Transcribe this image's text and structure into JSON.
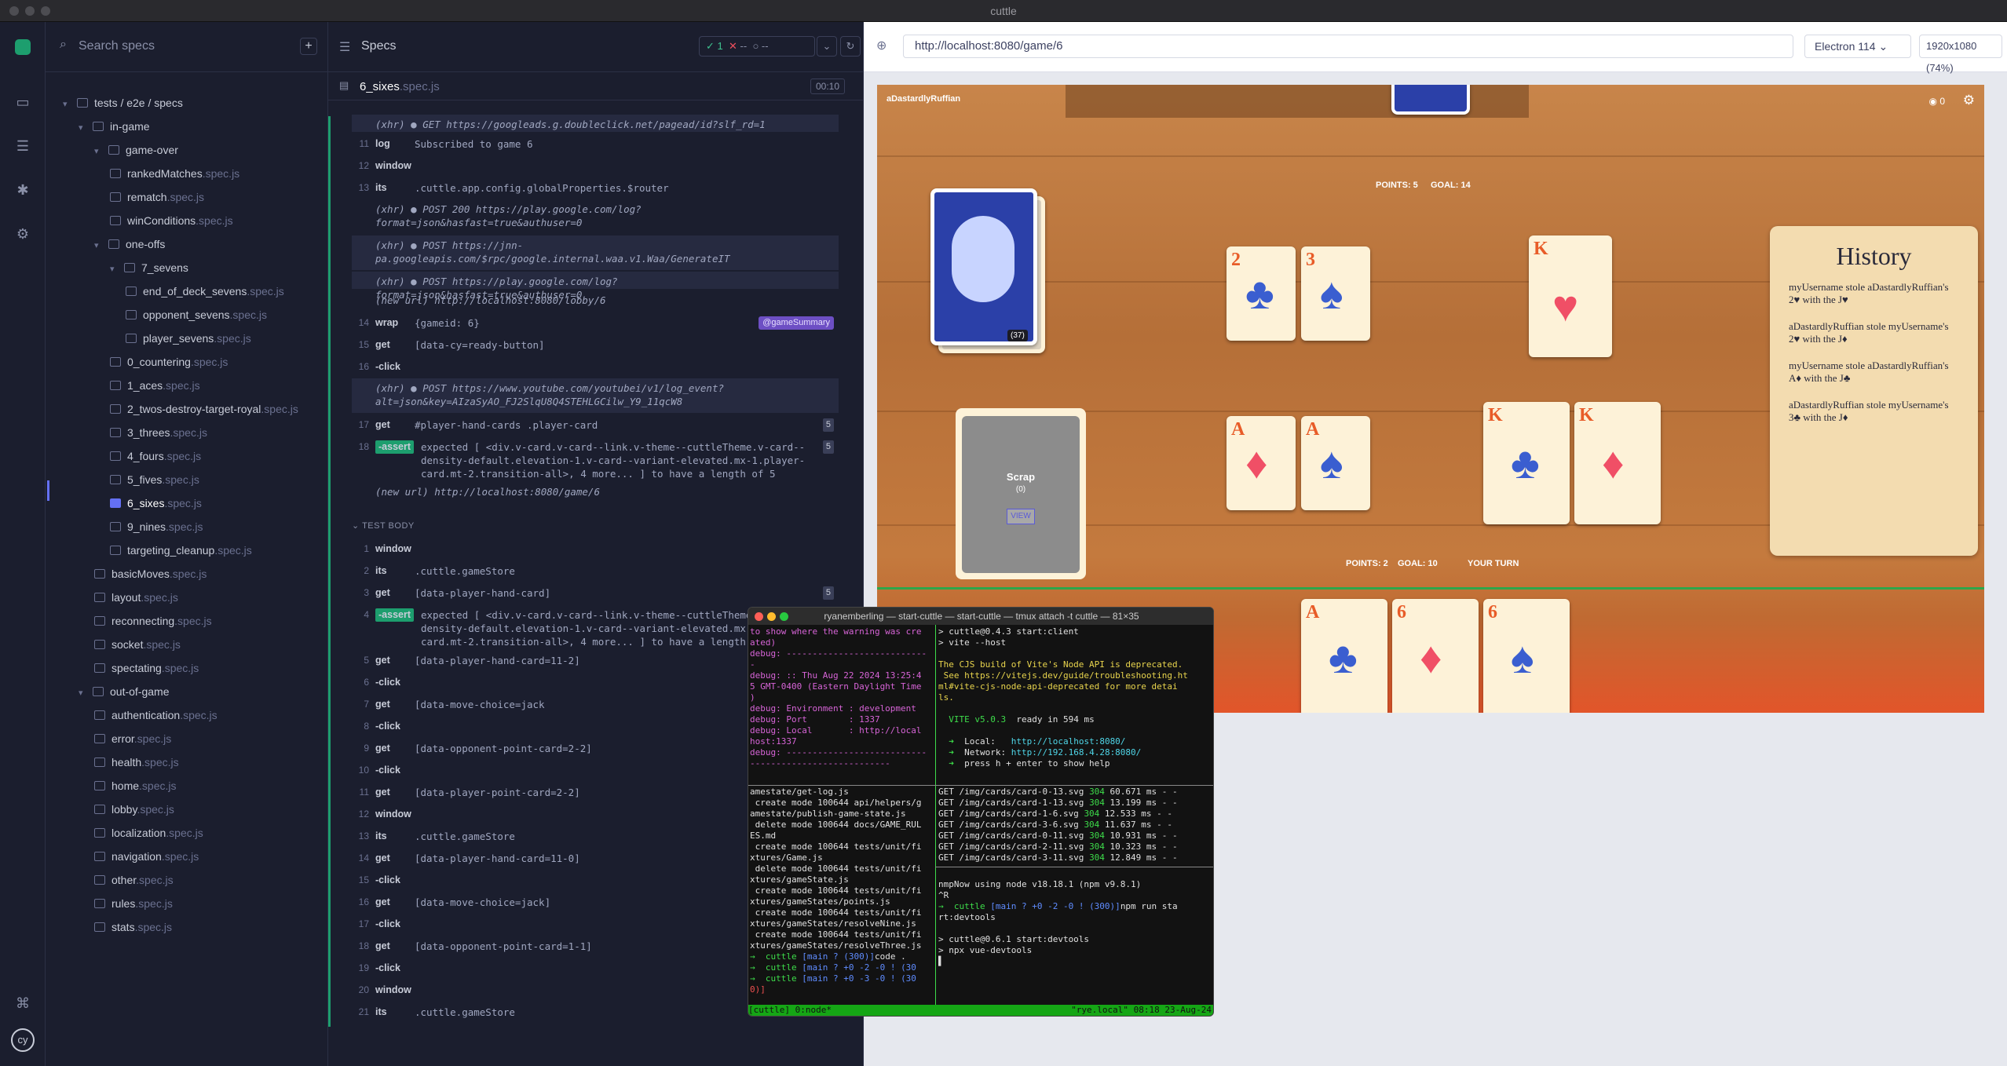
{
  "window_title": "cuttle",
  "specs_panel": {
    "search_placeholder": "Search specs",
    "add_label": "+",
    "root_label": "tests / e2e / specs",
    "tree": [
      {
        "label": "in-game",
        "ext": "",
        "kind": "folder",
        "depth": 1
      },
      {
        "label": "game-over",
        "ext": "",
        "kind": "folder",
        "depth": 2
      },
      {
        "label": "rankedMatches",
        "ext": ".spec.js",
        "kind": "file",
        "depth": 3
      },
      {
        "label": "rematch",
        "ext": ".spec.js",
        "kind": "file",
        "depth": 3
      },
      {
        "label": "winConditions",
        "ext": ".spec.js",
        "kind": "file",
        "depth": 3
      },
      {
        "label": "one-offs",
        "ext": "",
        "kind": "folder",
        "depth": 2
      },
      {
        "label": "7_sevens",
        "ext": "",
        "kind": "folder",
        "depth": 3
      },
      {
        "label": "end_of_deck_sevens",
        "ext": ".spec.js",
        "kind": "file",
        "depth": 4
      },
      {
        "label": "opponent_sevens",
        "ext": ".spec.js",
        "kind": "file",
        "depth": 4
      },
      {
        "label": "player_sevens",
        "ext": ".spec.js",
        "kind": "file",
        "depth": 4
      },
      {
        "label": "0_countering",
        "ext": ".spec.js",
        "kind": "file",
        "depth": 3
      },
      {
        "label": "1_aces",
        "ext": ".spec.js",
        "kind": "file",
        "depth": 3
      },
      {
        "label": "2_twos-destroy-target-royal",
        "ext": ".spec.js",
        "kind": "file",
        "depth": 3
      },
      {
        "label": "3_threes",
        "ext": ".spec.js",
        "kind": "file",
        "depth": 3
      },
      {
        "label": "4_fours",
        "ext": ".spec.js",
        "kind": "file",
        "depth": 3
      },
      {
        "label": "5_fives",
        "ext": ".spec.js",
        "kind": "file",
        "depth": 3
      },
      {
        "label": "6_sixes",
        "ext": ".spec.js",
        "kind": "file",
        "depth": 3,
        "active": true
      },
      {
        "label": "9_nines",
        "ext": ".spec.js",
        "kind": "file",
        "depth": 3
      },
      {
        "label": "targeting_cleanup",
        "ext": ".spec.js",
        "kind": "file",
        "depth": 3
      },
      {
        "label": "basicMoves",
        "ext": ".spec.js",
        "kind": "file",
        "depth": 2
      },
      {
        "label": "layout",
        "ext": ".spec.js",
        "kind": "file",
        "depth": 2
      },
      {
        "label": "reconnecting",
        "ext": ".spec.js",
        "kind": "file",
        "depth": 2
      },
      {
        "label": "socket",
        "ext": ".spec.js",
        "kind": "file",
        "depth": 2
      },
      {
        "label": "spectating",
        "ext": ".spec.js",
        "kind": "file",
        "depth": 2
      },
      {
        "label": "out-of-game",
        "ext": "",
        "kind": "folder",
        "depth": 1
      },
      {
        "label": "authentication",
        "ext": ".spec.js",
        "kind": "file",
        "depth": 2
      },
      {
        "label": "error",
        "ext": ".spec.js",
        "kind": "file",
        "depth": 2
      },
      {
        "label": "health",
        "ext": ".spec.js",
        "kind": "file",
        "depth": 2
      },
      {
        "label": "home",
        "ext": ".spec.js",
        "kind": "file",
        "depth": 2
      },
      {
        "label": "lobby",
        "ext": ".spec.js",
        "kind": "file",
        "depth": 2
      },
      {
        "label": "localization",
        "ext": ".spec.js",
        "kind": "file",
        "depth": 2
      },
      {
        "label": "navigation",
        "ext": ".spec.js",
        "kind": "file",
        "depth": 2
      },
      {
        "label": "other",
        "ext": ".spec.js",
        "kind": "file",
        "depth": 2
      },
      {
        "label": "rules",
        "ext": ".spec.js",
        "kind": "file",
        "depth": 2
      },
      {
        "label": "stats",
        "ext": ".spec.js",
        "kind": "file",
        "depth": 2
      }
    ]
  },
  "command_log": {
    "header_title": "Specs",
    "passed": "1",
    "failed": "--",
    "pending": "--",
    "spec_name": "6_sixes",
    "spec_ext": ".spec.js",
    "duration": "00:10",
    "test_body_label": "TEST BODY",
    "before_rows": [
      {
        "num": "",
        "name": "",
        "msg": "(xhr)  ● GET https://googleads.g.doubleclick.net/pagead/id?slf_rd=1",
        "xhr": true
      },
      {
        "num": "11",
        "name": "log",
        "msg": "Subscribed to game 6"
      },
      {
        "num": "12",
        "name": "window",
        "msg": ""
      },
      {
        "num": "13",
        "name": "its",
        "msg": ".cuttle.app.config.globalProperties.$router"
      },
      {
        "num": "",
        "name": "",
        "msg": "(xhr)  ● POST 200 https://play.google.com/log?format=json&hasfast=true&authuser=0",
        "xhr": false
      },
      {
        "num": "",
        "name": "",
        "msg": "(xhr)  ● POST https://jnn-pa.googleapis.com/$rpc/google.internal.waa.v1.Waa/GenerateIT",
        "xhr": true
      },
      {
        "num": "",
        "name": "",
        "msg": "(xhr)  ● POST https://play.google.com/log?format=json&hasfast=true&authuser=0",
        "xhr": true
      },
      {
        "num": "",
        "name": "",
        "msg": "(new url)  http://localhost:8080/lobby/6",
        "xhr": false
      },
      {
        "num": "14",
        "name": "wrap",
        "msg": "{gameid: 6}",
        "alias": "@gameSummary"
      },
      {
        "num": "15",
        "name": "get",
        "msg": "[data-cy=ready-button]"
      },
      {
        "num": "16",
        "name": "-click",
        "msg": ""
      },
      {
        "num": "",
        "name": "",
        "msg": "(xhr)  ● POST https://www.youtube.com/youtubei/v1/log_event?alt=json&key=AIzaSyAO_FJ2SlqU8Q4STEHLGCilw_Y9_11qcW8",
        "xhr": true
      },
      {
        "num": "17",
        "name": "get",
        "msg": "#player-hand-cards .player-card",
        "badge": "5"
      },
      {
        "num": "18",
        "name": "-assert",
        "msg": "expected [ <div.v-card.v-card--link.v-theme--cuttleTheme.v-card--density-default.elevation-1.v-card--variant-elevated.mx-1.player-card.mt-2.transition-all>, 4 more... ] to have a length of 5",
        "badge": "5",
        "assert": true
      },
      {
        "num": "",
        "name": "",
        "msg": "(new url)  http://localhost:8080/game/6",
        "xhr": false
      }
    ],
    "body_rows": [
      {
        "num": "1",
        "name": "window",
        "msg": ""
      },
      {
        "num": "2",
        "name": "its",
        "msg": ".cuttle.gameStore"
      },
      {
        "num": "3",
        "name": "get",
        "msg": "[data-player-hand-card]",
        "badge": "5"
      },
      {
        "num": "4",
        "name": "-assert",
        "msg": "expected [ <div.v-card.v-card--link.v-theme--cuttleTheme.v-card--density-default.elevation-1.v-card--variant-elevated.mx-1.player-card.mt-2.transition-all>, 4 more... ] to have a length of 5",
        "assert": true
      },
      {
        "num": "5",
        "name": "get",
        "msg": "[data-player-hand-card=11-2]"
      },
      {
        "num": "6",
        "name": "-click",
        "msg": ""
      },
      {
        "num": "7",
        "name": "get",
        "msg": "[data-move-choice=jack"
      },
      {
        "num": "8",
        "name": "-click",
        "msg": ""
      },
      {
        "num": "9",
        "name": "get",
        "msg": "[data-opponent-point-card=2-2]"
      },
      {
        "num": "10",
        "name": "-click",
        "msg": ""
      },
      {
        "num": "11",
        "name": "get",
        "msg": "[data-player-point-card=2-2]"
      },
      {
        "num": "12",
        "name": "window",
        "msg": ""
      },
      {
        "num": "13",
        "name": "its",
        "msg": ".cuttle.gameStore"
      },
      {
        "num": "14",
        "name": "get",
        "msg": "[data-player-hand-card=11-0]"
      },
      {
        "num": "15",
        "name": "-click",
        "msg": ""
      },
      {
        "num": "16",
        "name": "get",
        "msg": "[data-move-choice=jack]"
      },
      {
        "num": "17",
        "name": "-click",
        "msg": ""
      },
      {
        "num": "18",
        "name": "get",
        "msg": "[data-opponent-point-card=1-1]"
      },
      {
        "num": "19",
        "name": "-click",
        "msg": ""
      },
      {
        "num": "20",
        "name": "window",
        "msg": ""
      },
      {
        "num": "21",
        "name": "its",
        "msg": ".cuttle.gameStore"
      }
    ]
  },
  "browser": {
    "url": "http://localhost:8080/game/6",
    "browser_name": "Electron 114",
    "viewport": "1920x1080 (74%)"
  },
  "game": {
    "opponent_name": "aDastardlyRuffian",
    "spectators": "0",
    "opponent_points": "POINTS: 5",
    "opponent_goal": "GOAL: 14",
    "deck_count": "(37)",
    "scrap_label": "Scrap",
    "scrap_count": "(0)",
    "view_label": "VIEW",
    "player_points": "POINTS: 2",
    "player_goal": "GOAL: 10",
    "turn_label": "YOUR TURN",
    "history_title": "History",
    "history": [
      "myUsername stole aDastardlyRuffian's 2♥ with the J♥",
      "aDastardlyRuffian stole myUsername's 2♥ with the J♦",
      "myUsername stole aDastardlyRuffian's A♦ with the J♣",
      "aDastardlyRuffian stole myUsername's 3♣ with the J♦"
    ],
    "opponent_point_cards": [
      {
        "rank": "2",
        "suit": "♣"
      },
      {
        "rank": "3",
        "suit": "♠"
      }
    ],
    "opponent_royal": {
      "rank": "K",
      "suit": "♥"
    },
    "player_point_cards": [
      {
        "rank": "A",
        "suit": "♦"
      },
      {
        "rank": "A",
        "suit": "♠"
      }
    ],
    "player_royals": [
      {
        "rank": "K",
        "suit": "♣"
      },
      {
        "rank": "K",
        "suit": "♦"
      }
    ],
    "hand": [
      {
        "rank": "A",
        "suit": "♣"
      },
      {
        "rank": "6",
        "suit": "♦"
      },
      {
        "rank": "6",
        "suit": "♠"
      }
    ]
  },
  "terminal": {
    "title": "ryanemberling — start-cuttle — start-cuttle — tmux attach -t cuttle — 81×35",
    "status_left": "[cuttle] 0:node*",
    "status_right": "\"rye.local\" 08:18 23-Aug-24"
  }
}
